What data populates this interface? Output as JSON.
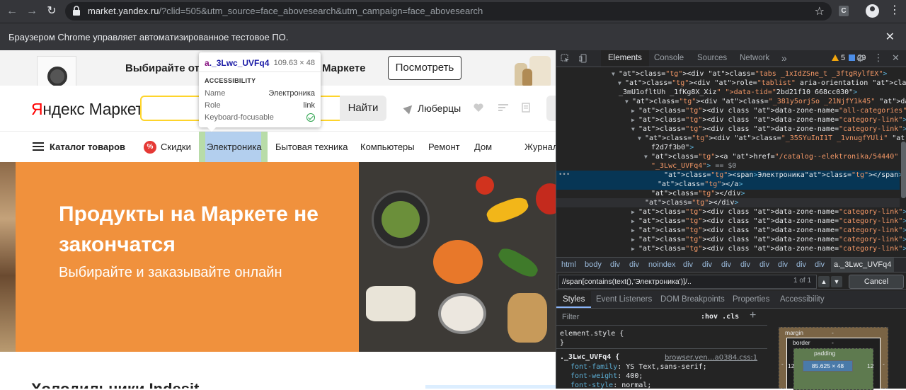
{
  "browser": {
    "url_host": "market.yandex.ru",
    "url_rest": "/?clid=505&utm_source=face_abovesearch&utm_campaign=face_abovesearch",
    "extension_label": "C",
    "infobar_text": "Браузером Chrome управляет автоматизированное тестовое ПО."
  },
  "page": {
    "ad": {
      "text_left": "Выбирайте отв",
      "text_right": "Маркете",
      "button": "Посмотреть"
    },
    "header": {
      "logo_ya": "Я",
      "logo_rest": "ндекс Маркет",
      "search_button": "Найти",
      "location": "Люберцы"
    },
    "nav": {
      "catalog": "Каталог товаров",
      "discount_badge": "%",
      "links": [
        "Скидки",
        "Электроника",
        "Бытовая техника",
        "Компьютеры",
        "Ремонт",
        "Дом",
        "Журнал"
      ]
    },
    "hero": {
      "title": "Продукты на Маркете не закончатся",
      "subtitle": "Выбирайте и заказывайте онлайн"
    },
    "below_title": "Холодильники Indesit"
  },
  "tooltip": {
    "tag": "a",
    "cls": "._3Lwc_UVFq4",
    "dims": "109.63 × 48",
    "section": "ACCESSIBILITY",
    "rows": [
      {
        "k": "Name",
        "v": "Электроника"
      },
      {
        "k": "Role",
        "v": "link"
      },
      {
        "k": "Keyboard-focusable",
        "v": ""
      }
    ]
  },
  "devtools": {
    "tabs": [
      "Elements",
      "Console",
      "Sources",
      "Network"
    ],
    "more": "»",
    "warnings": "5",
    "messages": "29",
    "dom": [
      {
        "t": "▼",
        "html": "<div class=\"tabs _1xIdZSne_t _3ftgRylfEX\">"
      },
      {
        "t": "▼",
        "html": "<div role=\"tablist\" aria-orientation class=\"SyJTASPsrT"
      },
      {
        "t": "",
        "html": "_3mU1ofltUh _1fKg8X_Xiz\" data-tid=\"2bd21f10 668cc030\">"
      },
      {
        "t": "▼",
        "html": "<div class=\"_381y5orjSo _21NjfY1k45\" data-tid=\"f2d7f3b0\">"
      },
      {
        "t": "▶",
        "html": "<div class data-zone-name=\"all-categories\">…</div>"
      },
      {
        "t": "▶",
        "html": "<div class data-zone-name=\"category-link\">…</div>"
      },
      {
        "t": "▼",
        "html": "<div class data-zone-name=\"category-link\">"
      },
      {
        "t": "▼",
        "html": "<div class=\"_35SYuInI1T _1vnugfYUli\" data-tid=\"acbe4a11"
      },
      {
        "t": "",
        "html": "f2d7f3b0\">"
      },
      {
        "t": "▼",
        "html": "<a href=\"/catalog--elektronika/54440\" class="
      },
      {
        "t": "",
        "html": "\"_3Lwc_UVFq4\"> == $0"
      },
      {
        "t": "",
        "html": "<span>Электроника</span>"
      },
      {
        "t": "",
        "html": "</a>"
      },
      {
        "t": "",
        "html": "</div>"
      },
      {
        "t": "",
        "html": "</div>"
      },
      {
        "t": "▶",
        "html": "<div class data-zone-name=\"category-link\">…</div>"
      },
      {
        "t": "▶",
        "html": "<div class data-zone-name=\"category-link\">…</div>"
      },
      {
        "t": "▶",
        "html": "<div class data-zone-name=\"category-link\">…</div>"
      },
      {
        "t": "▶",
        "html": "<div class data-zone-name=\"category-link\">…</div>"
      },
      {
        "t": "▶",
        "html": "<div class data-zone-name=\"category-link\">…</div>"
      }
    ],
    "gutter": "•••",
    "breadcrumbs": [
      "html",
      "body",
      "div",
      "div",
      "noindex",
      "div",
      "div",
      "div",
      "div",
      "div",
      "div",
      "div",
      "div",
      "a._3Lwc_UVFq4"
    ],
    "xpath": "//span[contains(text(),'Электроника')]/..",
    "xpath_count": "1 of 1",
    "cancel": "Cancel",
    "style_tabs": [
      "Styles",
      "Event Listeners",
      "DOM Breakpoints",
      "Properties",
      "Accessibility"
    ],
    "filter": "Filter",
    "hov_cls": ":hov  .cls",
    "plus": "+",
    "element_style": "element.style {",
    "close_brace": "}",
    "rule_selector": "._3Lwc_UVFq4 {",
    "rule_source": "browser.ven…a0384.css:1",
    "props": [
      {
        "n": "font-family",
        "v": "YS Text,sans-serif;"
      },
      {
        "n": "font-weight",
        "v": "400;"
      },
      {
        "n": "font-style",
        "v": "normal;"
      }
    ],
    "box": {
      "margin": "margin",
      "margin_val": "-",
      "border": "border",
      "border_val": "-",
      "padding": "padding",
      "padding_val": "-",
      "left": "12",
      "right": "12",
      "content": "85.625 × 48"
    }
  }
}
